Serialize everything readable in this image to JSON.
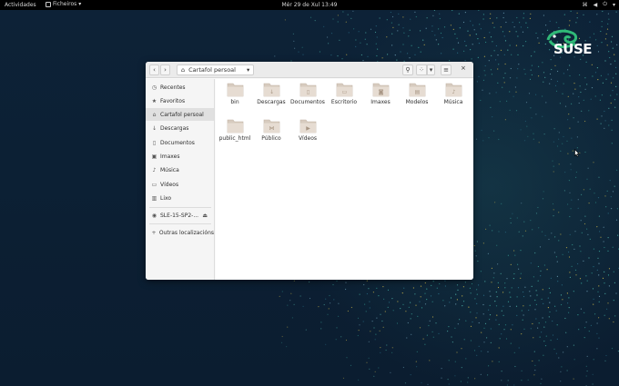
{
  "topbar": {
    "activities": "Actividades",
    "app_name": "Ficheiros",
    "clock": "Mér 29 de Xul  13:49"
  },
  "desktop": {
    "logo_text": "SUSE",
    "accent": "#30ba78"
  },
  "window": {
    "path_label": "Cartafol persoal",
    "sidebar": {
      "items": [
        {
          "label": "Recentes",
          "icon": "clock-icon"
        },
        {
          "label": "Favoritos",
          "icon": "star-icon"
        },
        {
          "label": "Cartafol persoal",
          "icon": "home-icon",
          "active": true
        },
        {
          "label": "Descargas",
          "icon": "download-icon"
        },
        {
          "label": "Documentos",
          "icon": "document-icon"
        },
        {
          "label": "Imaxes",
          "icon": "image-icon"
        },
        {
          "label": "Música",
          "icon": "music-icon"
        },
        {
          "label": "Vídeos",
          "icon": "video-icon"
        },
        {
          "label": "Lixo",
          "icon": "trash-icon"
        }
      ],
      "device": {
        "label": "SLE-15-SP2-...",
        "icon": "disc-icon"
      },
      "other": {
        "label": "Outras localizacións",
        "icon": "plus-icon"
      }
    },
    "files": [
      {
        "label": "bin",
        "icon": "folder-icon"
      },
      {
        "label": "Descargas",
        "icon": "folder-download-icon"
      },
      {
        "label": "Documentos",
        "icon": "folder-document-icon"
      },
      {
        "label": "Escritorio",
        "icon": "folder-desktop-icon"
      },
      {
        "label": "Imaxes",
        "icon": "folder-image-icon"
      },
      {
        "label": "Modelos",
        "icon": "folder-template-icon"
      },
      {
        "label": "Música",
        "icon": "folder-music-icon"
      },
      {
        "label": "public_html",
        "icon": "folder-icon"
      },
      {
        "label": "Público",
        "icon": "folder-share-icon"
      },
      {
        "label": "Vídeos",
        "icon": "folder-video-icon"
      }
    ]
  }
}
